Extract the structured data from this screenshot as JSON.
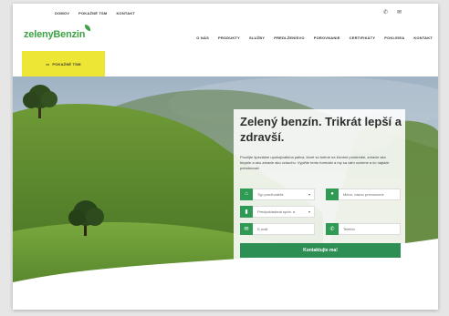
{
  "topbar": {
    "links": [
      "DOMOV",
      "POKAŽNÉ TSM",
      "KONTAKT"
    ]
  },
  "logo": "zelenyBenzin",
  "nav": [
    "O NÁS",
    "PRODUKTY",
    "SLUŽBY",
    "PREDLŽENÍSVO",
    "POROVNANIE",
    "CERTIFIKÁTY",
    "POKLEIEA",
    "KONTAKT"
  ],
  "cta": {
    "label": "POKAŽNÉ TSM"
  },
  "hero": {
    "title": "Zelený benzín. Trikrát lepší a zdravší.",
    "description": "Použijte špeciálne upokojivatkina palivá, ktoré sú šetrné na životné prostredie, zdravie ako bicykle a ako zdravie ako vzduchu. Vyplňte tento formulár a my sa vám ozveme a čo najskôr pohotovosti."
  },
  "form": {
    "type_placeholder": "Typ používateľa",
    "name_placeholder": "Meno, názov prevozovne",
    "consumption_placeholder": "Predpokladaná spotr. a",
    "email_placeholder": "E-mail",
    "phone_placeholder": "Telefón",
    "submit_label": "Kontaktujte ma!"
  },
  "colors": {
    "accent_green": "#2d8f54",
    "logo_green": "#3da345",
    "cta_yellow": "#ede634"
  }
}
